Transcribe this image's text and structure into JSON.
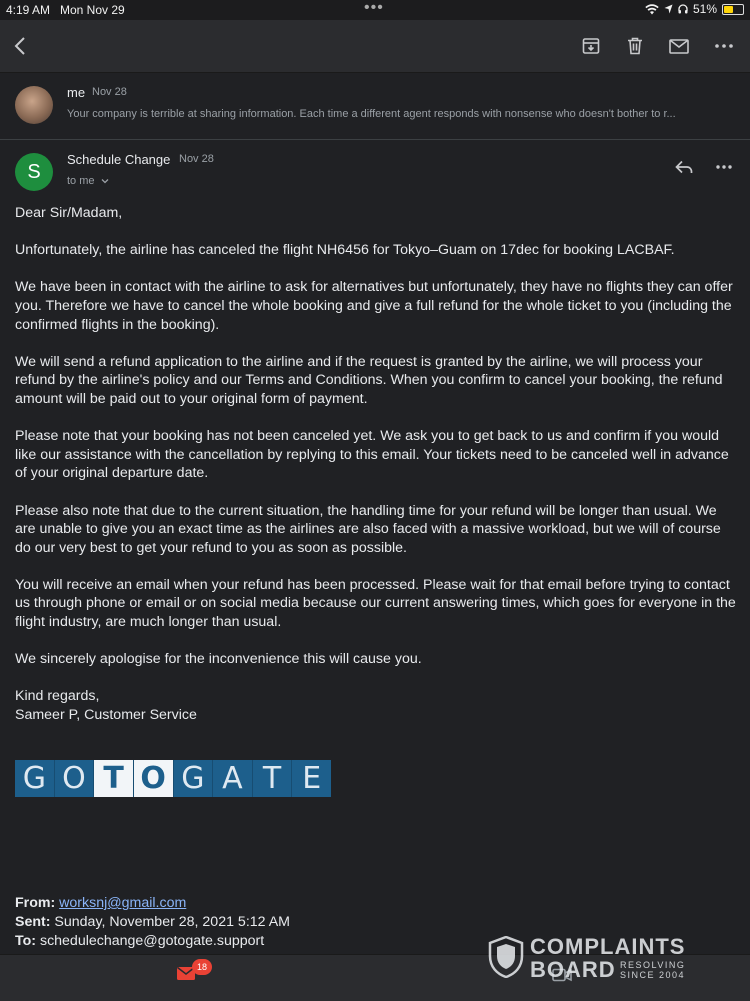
{
  "status_bar": {
    "time": "4:19 AM",
    "date": "Mon Nov 29",
    "battery": "51%",
    "battery_level": 0.51
  },
  "toolbar": {
    "back_icon": "chevron-left-icon",
    "archive_icon": "archive-icon",
    "delete_icon": "trash-icon",
    "mark_unread_icon": "mail-icon",
    "more_icon": "more-horizontal-icon"
  },
  "thread": {
    "collapsed": {
      "sender": "me",
      "date": "Nov 28",
      "snippet": "Your company is terrible at sharing information. Each time a different agent responds with nonsense who doesn't bother to r..."
    },
    "message": {
      "avatar_letter": "S",
      "avatar_color": "#1e8e3e",
      "sender": "Schedule Change",
      "date": "Nov 28",
      "recipient": "to me",
      "paragraphs": [
        "Dear Sir/Madam,",
        "Unfortunately, the airline has canceled the flight NH6456 for Tokyo–Guam  on 17dec  for booking LACBAF.",
        "We have been in contact with the airline to ask for alternatives but unfortunately, they have no flights they can offer you. Therefore we have to cancel the whole booking and give a full refund for the whole ticket to you (including the confirmed flights in the booking).",
        "We will send a refund application to the airline and if the request is granted by the airline, we will process your refund by the airline's policy and our Terms and Conditions. When you confirm to cancel your booking, the refund amount will be paid out to your original form of payment.",
        "Please note that your booking has not been canceled yet. We ask you to get back to us and confirm if you would like our assistance with the cancellation by replying to this email. Your tickets need to be canceled well in advance of your original departure date.",
        "Please also note that due to the current situation, the handling time for your refund will be longer than usual. We are unable to give you an exact time as the airlines are also faced with a massive workload, but we will of course do our very best to get your refund to you as soon as possible.",
        "You will receive an email when your refund has been processed. Please wait for that email before trying to contact us through phone or email or on social media because our current answering times, which goes for everyone in the flight industry, are much longer than usual.",
        "We sincerely apologise for the inconvenience this will cause you."
      ],
      "sign_off": "Kind regards,",
      "signature": "Sameer P, Customer Service",
      "logo_letters": [
        "G",
        "O",
        "T",
        "O",
        "G",
        "A",
        "T",
        "E"
      ],
      "logo_color": "#1d5f8c",
      "forwarded": {
        "from_label": "From:",
        "from_value": "worksnj@gmail.com",
        "sent_label": "Sent:",
        "sent_value": "Sunday, November 28, 2021 5:12 AM",
        "to_label": "To:",
        "to_value": "schedulechange@gotogate.support"
      }
    }
  },
  "bottom_bar": {
    "mail_badge": "18"
  },
  "watermark": {
    "line1": "COMPLAINTS",
    "line2": "BOARD",
    "tag1": "RESOLVING",
    "tag2": "SINCE 2004"
  }
}
